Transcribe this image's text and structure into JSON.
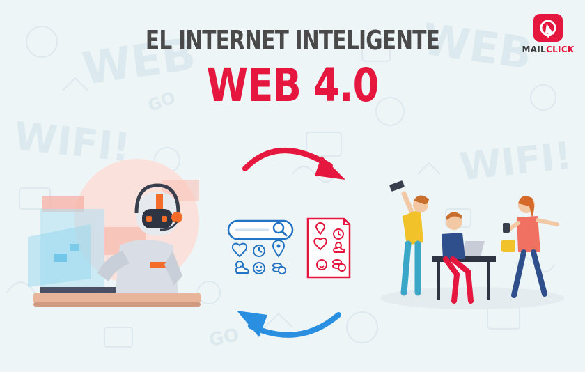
{
  "heading": {
    "line1": "EL INTERNET INTELIGENTE",
    "line2": "WEB 4.0"
  },
  "brand": {
    "name_part1": "MAIL",
    "name_part2": "CLICK",
    "icon": "cursor-click-icon"
  },
  "background_doodles": [
    "WEB",
    "WIFI!",
    "WEB",
    "WIFI!",
    "GO",
    "GO"
  ],
  "panels": {
    "search_box_icon": "magnifier-icon",
    "search_icons": [
      "heart-pulse-icon",
      "clock-icon",
      "location-pin-icon",
      "weather-icon",
      "smiley-icon",
      "coins-icon"
    ],
    "document_icons": [
      "location-pin-icon",
      "heart-pulse-icon",
      "clock-icon",
      "smiley-icon",
      "weather-icon",
      "coins-icon"
    ]
  },
  "colors": {
    "accent": "#e5173f",
    "title_dark": "#4a4a4a",
    "arrow_red": "#e5173f",
    "arrow_blue": "#2a8fe0",
    "icon_blue": "#2474c6"
  }
}
